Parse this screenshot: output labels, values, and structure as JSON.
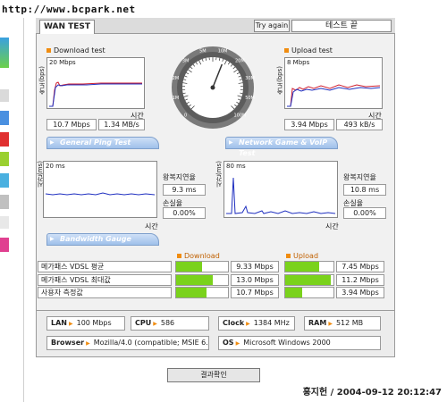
{
  "url": "http://www.bcpark.net",
  "header": {
    "tab": "WAN TEST",
    "try_again": "Try again",
    "status": "테스트 끝"
  },
  "download": {
    "title": "Download test",
    "ymax": "20 Mbps",
    "yaxis": "속도(bps)",
    "xaxis": "시간",
    "speed": "10.7 Mbps",
    "bytes": "1.34 MB/s"
  },
  "upload": {
    "title": "Upload test",
    "ymax": "8 Mbps",
    "yaxis": "속도(bps)",
    "xaxis": "시간",
    "speed": "3.94 Mbps",
    "bytes": "493 kB/s"
  },
  "ping": {
    "bar": "General Ping Test",
    "ymax": "20 ms",
    "yaxis": "시간(ms)",
    "xaxis": "시간",
    "delay_label": "왕복지연율",
    "delay": "9.3 ms",
    "loss_label": "손실율",
    "loss": "0.00%"
  },
  "game": {
    "bar": "Network Game & VoIP Test",
    "ymax": "80 ms",
    "yaxis": "시간(ms)",
    "xaxis": "시간",
    "delay_label": "왕복지연율",
    "delay": "10.8 ms",
    "loss_label": "손실율",
    "loss": "0.00%"
  },
  "gauge_bar": "Bandwidth Gauge",
  "gauge_headers": {
    "download": "Download",
    "upload": "Upload"
  },
  "gauge_rows": [
    {
      "label": "메가패스 VDSL 평균",
      "down": "9.33 Mbps",
      "down_fill": 0.5,
      "up": "7.45 Mbps",
      "up_fill": 0.7
    },
    {
      "label": "메가패스 VDSL 최대값",
      "down": "13.0 Mbps",
      "down_fill": 0.7,
      "up": "11.2 Mbps",
      "up_fill": 0.95
    },
    {
      "label": "사용자 측정값",
      "down": "10.7 Mbps",
      "down_fill": 0.58,
      "up": "3.94 Mbps",
      "up_fill": 0.35
    }
  ],
  "info": {
    "lan_label": "LAN",
    "lan": "100 Mbps",
    "cpu_label": "CPU",
    "cpu": "586",
    "clock_label": "Clock",
    "clock": "1384 MHz",
    "ram_label": "RAM",
    "ram": "512 MB",
    "browser_label": "Browser",
    "browser": "Mozilla/4.0 (compatible; MSIE 6.0",
    "os_label": "OS",
    "os": "Microsoft Windows 2000"
  },
  "result_button": "결과확인",
  "footer": "홍지헌 / 2004-09-12 20:12:47",
  "speedometer": {
    "ticks": [
      "0",
      "1M",
      "2M",
      "3M",
      "5M",
      "10M",
      "20M",
      "30M",
      "50M",
      "100M"
    ],
    "needle_fill": 0.58
  },
  "colors": {
    "accent": "#f08c10",
    "bar_green": "#7ad21c",
    "section_blue": "#9fc0ea"
  }
}
